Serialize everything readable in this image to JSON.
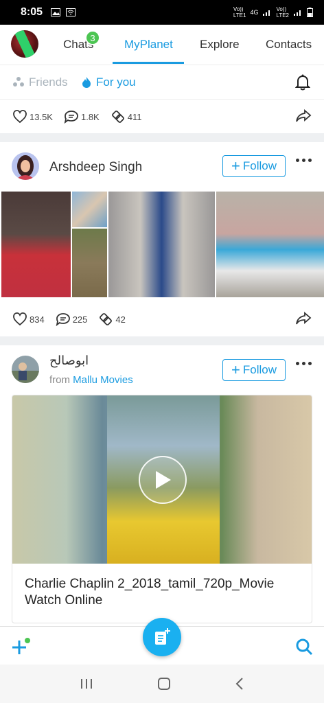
{
  "status_bar": {
    "time": "8:05",
    "network_left": "Vo))\nLTE1",
    "network_mid": "4G",
    "network_right": "Vo))\nLTE2"
  },
  "top_nav": {
    "tabs": [
      {
        "label": "Chats",
        "badge": "3"
      },
      {
        "label": "MyPlanet"
      },
      {
        "label": "Explore"
      },
      {
        "label": "Contacts"
      }
    ],
    "active_tab": "MyPlanet"
  },
  "sub_nav": {
    "friends_label": "Friends",
    "for_you_label": "For you"
  },
  "post0": {
    "likes": "13.5K",
    "comments": "1.8K",
    "reshares": "411"
  },
  "post1": {
    "author": "Arshdeep Singh",
    "follow_label": "Follow",
    "likes": "834",
    "comments": "225",
    "reshares": "42"
  },
  "post2": {
    "author": "ابوصالح",
    "from_prefix": "from",
    "from_source": "Mallu Movies",
    "follow_label": "Follow",
    "caption": "Charlie Chaplin 2_2018_tamil_720p_Movie Watch Online"
  },
  "colors": {
    "accent": "#1a9be0",
    "badge": "#4cc552",
    "fab": "#1ab0f0"
  }
}
